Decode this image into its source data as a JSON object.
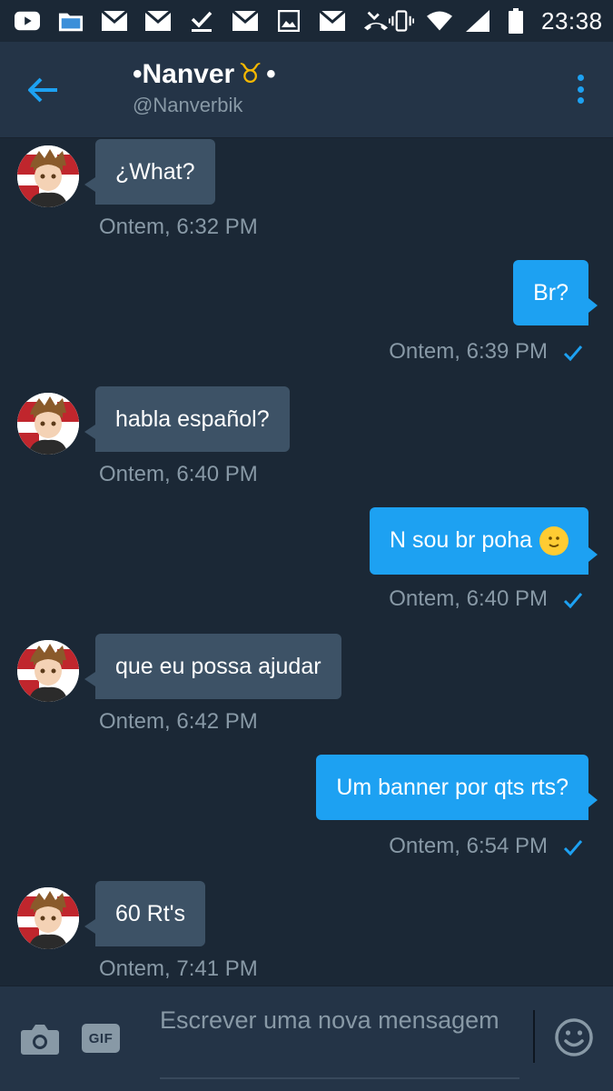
{
  "status_bar": {
    "time": "23:38",
    "left_icons": [
      "youtube-icon",
      "file-manager-icon",
      "mail-icon",
      "mail-icon",
      "checkmark-download-icon",
      "mail-icon",
      "image-icon",
      "mail-icon",
      "missed-call-icon"
    ],
    "right_icons": [
      "vibrate-icon",
      "wifi-icon",
      "signal-icon",
      "battery-icon"
    ]
  },
  "header": {
    "title": "•Nanver",
    "title_symbol": "♉",
    "title_suffix": "•",
    "handle": "@Nanverbik"
  },
  "messages": [
    {
      "direction": "in",
      "text": "¿What?",
      "time": "Ontem, 6:32 PM"
    },
    {
      "direction": "out",
      "text": "Br?",
      "time": "Ontem, 6:39 PM"
    },
    {
      "direction": "in",
      "text": "habla español?",
      "time": "Ontem, 6:40 PM"
    },
    {
      "direction": "out",
      "text": "N sou br poha",
      "time": "Ontem, 6:40 PM"
    },
    {
      "direction": "in",
      "text": "que eu possa ajudar",
      "time": "Ontem, 6:42 PM"
    },
    {
      "direction": "out",
      "text": "Um banner por qts rts?",
      "time": "Ontem, 6:54 PM"
    },
    {
      "direction": "in",
      "text": "60 Rt's",
      "time": "Ontem, 7:41 PM"
    }
  ],
  "composer": {
    "placeholder": "Escrever uma nova mensagem",
    "gif_label": "GIF"
  },
  "colors": {
    "background": "#1b2836",
    "header": "#243447",
    "accent": "#1da1f2",
    "incoming_bubble": "#3d5266",
    "muted_text": "#8899a6"
  }
}
